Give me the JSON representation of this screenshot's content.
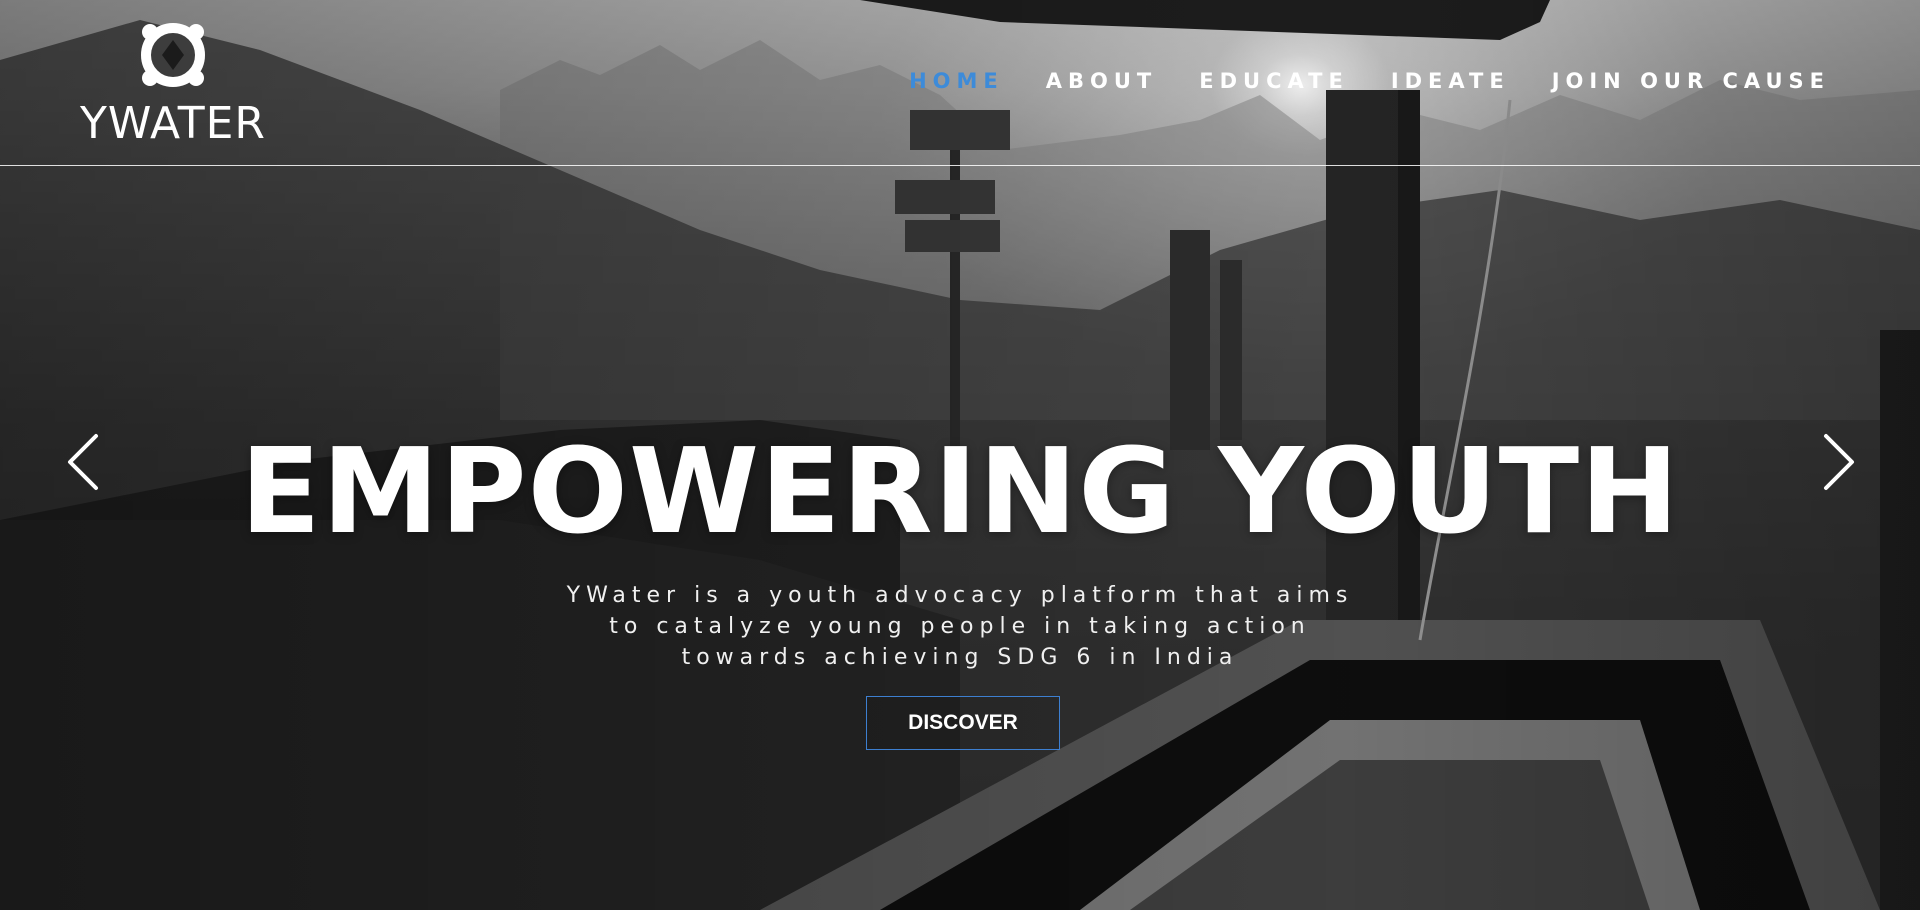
{
  "brand": {
    "name": "YWATER",
    "logo_icon": "ywater-logo-icon"
  },
  "nav": {
    "items": [
      {
        "label": "HOME",
        "active": true
      },
      {
        "label": "ABOUT",
        "active": false
      },
      {
        "label": "EDUCATE",
        "active": false
      },
      {
        "label": "IDEATE",
        "active": false
      },
      {
        "label": "JOIN OUR CAUSE",
        "active": false
      }
    ],
    "active_color": "#3d8bd9"
  },
  "hero": {
    "headline": "EMPOWERING YOUTH",
    "description_lines": [
      "YWater is a youth advocacy platform that aims",
      "to catalyze young people in taking action",
      "towards achieving SDG 6 in India"
    ],
    "cta_label": "DISCOVER",
    "cta_border_color": "#3d7fd0",
    "prev_icon": "chevron-left-icon",
    "next_icon": "chevron-right-icon",
    "background": "grayscale mountain landscape with wooden water trough at sunset"
  }
}
